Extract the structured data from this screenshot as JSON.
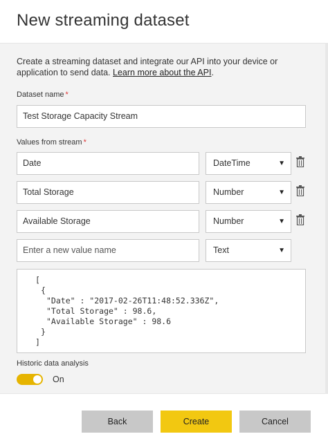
{
  "dialog": {
    "title": "New streaming dataset"
  },
  "intro": {
    "text": "Create a streaming dataset and integrate our API into your device or application to send data. ",
    "link": "Learn more about the API",
    "period": "."
  },
  "dataset": {
    "label": "Dataset name",
    "required": "*",
    "value": "Test Storage Capacity Stream"
  },
  "values": {
    "label": "Values from stream",
    "required": "*",
    "rows": [
      {
        "name": "Date",
        "type": "DateTime"
      },
      {
        "name": "Total Storage",
        "type": "Number"
      },
      {
        "name": "Available Storage",
        "type": "Number"
      },
      {
        "name": "Enter a new value name",
        "type": "Text"
      }
    ]
  },
  "code": {
    "lines": [
      "[",
      "{",
      "\"Date\" : \"2017-02-26T11:48:52.336Z\",",
      "\"Total Storage\" : 98.6,",
      "\"Available Storage\" : 98.6",
      "}",
      "]"
    ]
  },
  "historic": {
    "label": "Historic data analysis",
    "state": "On"
  },
  "footer": {
    "back": "Back",
    "create": "Create",
    "cancel": "Cancel"
  },
  "colors": {
    "accent": "#f2c811",
    "toggle": "#e6b400",
    "required": "#d33333"
  },
  "icons": {
    "delete": "trash-icon",
    "dropdown": "chevron-down-icon"
  }
}
